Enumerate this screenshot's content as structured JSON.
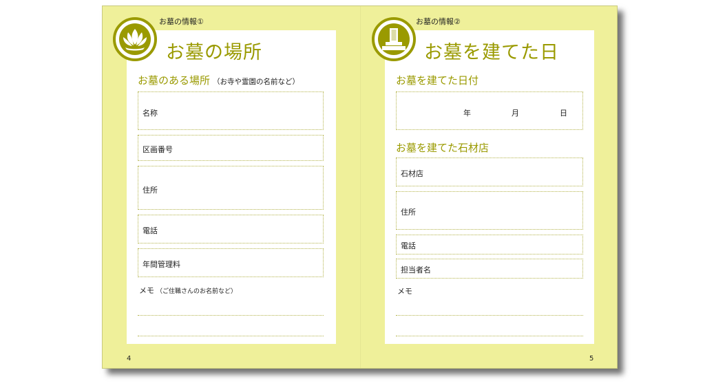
{
  "left_page": {
    "header": "お墓の情報①",
    "title": "お墓の場所",
    "section_title": "お墓のある場所",
    "section_sub": "（お寺や霊園の名前など）",
    "fields": [
      "名称",
      "区画番号",
      "住所",
      "電話",
      "年間管理料"
    ],
    "memo_label": "メモ",
    "memo_sub": "（ご住職さんのお名前など）",
    "page_number": "4",
    "emblem_icon": "lotus-icon"
  },
  "right_page": {
    "header": "お墓の情報②",
    "title": "お墓を建てた日",
    "date_section_title": "お墓を建てた日付",
    "date_units": [
      "年",
      "月",
      "日"
    ],
    "mason_section_title": "お墓を建てた石材店",
    "fields": [
      "石材店",
      "住所",
      "電話",
      "担当者名"
    ],
    "memo_label": "メモ",
    "page_number": "5",
    "emblem_icon": "gravestone-icon"
  },
  "colors": {
    "page_background": "#eff09a",
    "accent": "#9a9a00",
    "panel": "#ffffff"
  }
}
